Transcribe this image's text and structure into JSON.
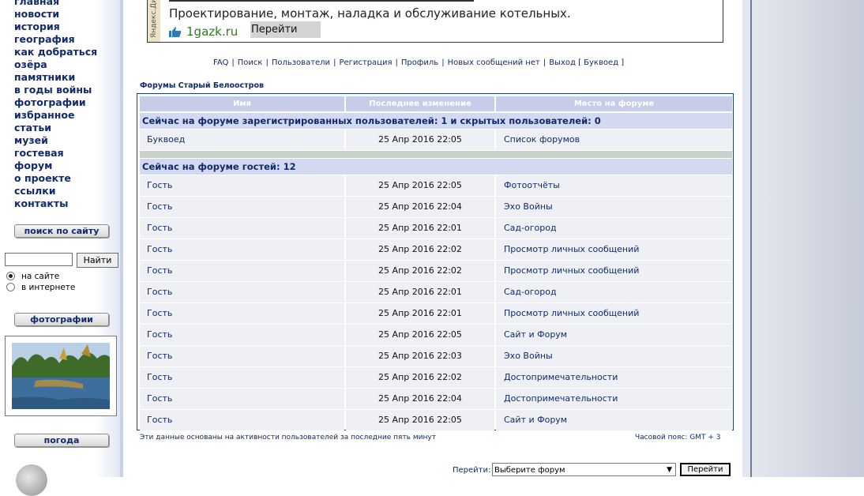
{
  "sidebar": {
    "nav": [
      "главная",
      "новости",
      "история",
      "география",
      "как добраться",
      "озёра",
      "памятники",
      "в годы войны",
      "фотографии",
      "избранное",
      "статьи",
      "музей",
      "гостевая",
      "форум",
      "о проекте",
      "ссылки",
      "контакты"
    ],
    "search_button": "поиск по сайту",
    "search_go": "Найти",
    "radio_site": "на сайте",
    "radio_web": "в интернете",
    "photos_button": "фотографии",
    "weather_button": "погода"
  },
  "ad": {
    "side_label": "Яндекс.Директ",
    "text": "Проектирование, монтаж, наладка и обслуживание котельных.",
    "site": "1gazk.ru",
    "button": "Перейти"
  },
  "toplinks": {
    "faq": "FAQ",
    "search": "Поиск",
    "users": "Пользователи",
    "register": "Регистрация",
    "profile": "Профиль",
    "no_new": "Новых сообщений нет",
    "logout": "Выход [ Буквоед ]"
  },
  "forum_title": "Форумы Старый Белоостров",
  "table": {
    "headers": [
      "Имя",
      "Последнее изменение",
      "Место на форуме"
    ],
    "registered_heading": "Сейчас на форуме зарегистрированных пользователей: 1 и скрытых пользователей: 0",
    "registered": [
      [
        "Буквоед",
        "25 Апр 2016 22:05",
        "Список форумов"
      ]
    ],
    "guests_heading": "Сейчас на форуме гостей: 12",
    "guests": [
      [
        "Гость",
        "25 Апр 2016 22:05",
        "Фотоотчёты"
      ],
      [
        "Гость",
        "25 Апр 2016 22:04",
        "Эхо Войны"
      ],
      [
        "Гость",
        "25 Апр 2016 22:01",
        "Сад-огород"
      ],
      [
        "Гость",
        "25 Апр 2016 22:02",
        "Просмотр личных сообщений"
      ],
      [
        "Гость",
        "25 Апр 2016 22:02",
        "Просмотр личных сообщений"
      ],
      [
        "Гость",
        "25 Апр 2016 22:01",
        "Сад-огород"
      ],
      [
        "Гость",
        "25 Апр 2016 22:01",
        "Просмотр личных сообщений"
      ],
      [
        "Гость",
        "25 Апр 2016 22:05",
        "Сайт и Форум"
      ],
      [
        "Гость",
        "25 Апр 2016 22:03",
        "Эхо Войны"
      ],
      [
        "Гость",
        "25 Апр 2016 22:02",
        "Достопримечательности"
      ],
      [
        "Гость",
        "25 Апр 2016 22:04",
        "Достопримечательности"
      ],
      [
        "Гость",
        "25 Апр 2016 22:05",
        "Сайт и Форум"
      ]
    ]
  },
  "footer": {
    "note": "Эти данные основаны на активности пользователей за последние пять минут",
    "timezone": "Часовой пояс: GMT + 3",
    "jump_label": "Перейти:",
    "jump_select": "Выберите форум",
    "jump_button": "Перейти"
  },
  "colors": {
    "link": "#102a6b",
    "header_bg": "#c6cde8",
    "row_bg": "#eef0f6",
    "accent_green": "#2d7a1f"
  }
}
